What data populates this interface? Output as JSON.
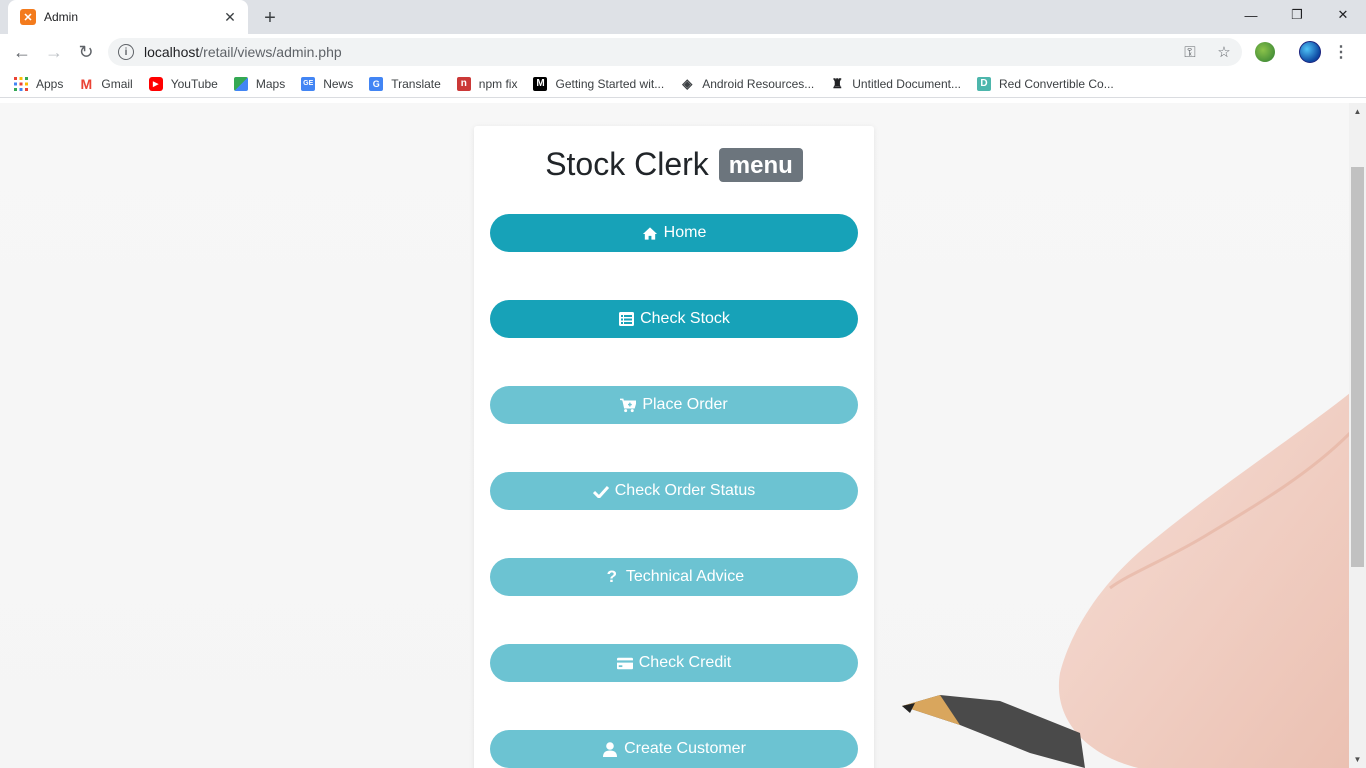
{
  "browser": {
    "tab": {
      "title": "Admin",
      "favicon": "xampp-icon"
    },
    "url": {
      "host": "localhost",
      "path": "/retail/views/admin.php"
    },
    "bookmarks": [
      {
        "label": "Apps",
        "icon": "apps-grid-icon"
      },
      {
        "label": "Gmail",
        "icon": "gmail-icon"
      },
      {
        "label": "YouTube",
        "icon": "youtube-icon"
      },
      {
        "label": "Maps",
        "icon": "maps-icon"
      },
      {
        "label": "News",
        "icon": "news-icon"
      },
      {
        "label": "Translate",
        "icon": "translate-icon"
      },
      {
        "label": "npm fix",
        "icon": "npm-icon"
      },
      {
        "label": "Getting Started wit...",
        "icon": "medium-icon"
      },
      {
        "label": "Android Resources...",
        "icon": "android-resources-icon"
      },
      {
        "label": "Untitled Document...",
        "icon": "document-icon"
      },
      {
        "label": "Red Convertible Co...",
        "icon": "d-icon"
      }
    ]
  },
  "page": {
    "title": "Stock Clerk",
    "badge": "menu",
    "buttons": [
      {
        "label": "Home",
        "icon": "home-icon",
        "style": "primary"
      },
      {
        "label": "Check Stock",
        "icon": "list-icon",
        "style": "primary"
      },
      {
        "label": "Place Order",
        "icon": "cart-plus-icon",
        "style": "light"
      },
      {
        "label": "Check Order Status",
        "icon": "check-icon",
        "style": "light"
      },
      {
        "label": "Technical Advice",
        "icon": "question-icon",
        "style": "light"
      },
      {
        "label": "Check Credit",
        "icon": "credit-card-icon",
        "style": "light"
      },
      {
        "label": "Create Customer",
        "icon": "user-icon",
        "style": "light"
      }
    ]
  },
  "colors": {
    "primary": "#17a2b8",
    "light": "#6cc3d2",
    "badge": "#6c757d"
  }
}
